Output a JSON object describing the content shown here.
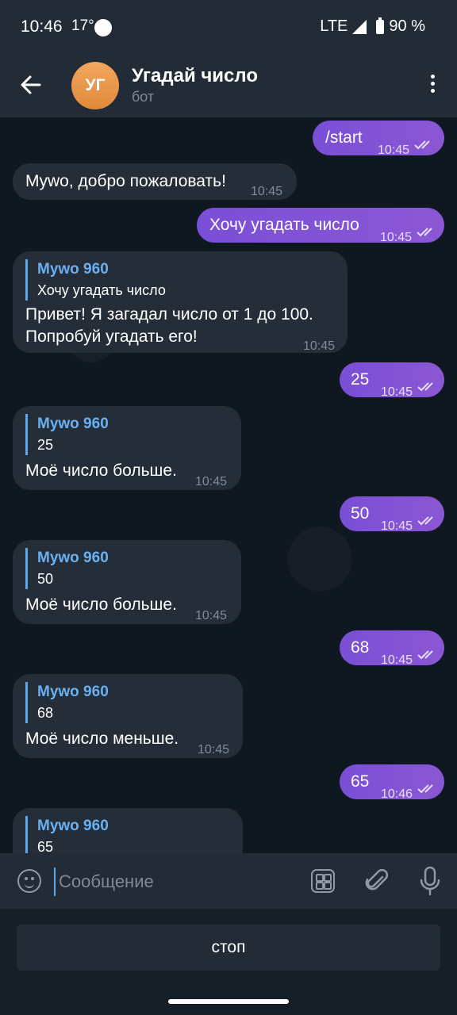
{
  "status_bar": {
    "time": "10:46",
    "temperature": "17°",
    "network": "LTE",
    "battery": "90 %"
  },
  "header": {
    "avatar_initials": "УГ",
    "title": "Угадай число",
    "subtitle": "бот"
  },
  "messages": [
    {
      "dir": "out",
      "text": "/start",
      "time": "10:45"
    },
    {
      "dir": "in",
      "text": "Мywo, добро пожаловать!",
      "time": "10:45"
    },
    {
      "dir": "out",
      "text": "Хочу угадать число",
      "time": "10:45"
    },
    {
      "dir": "in",
      "reply_name": "Мywo 960",
      "reply_text": "Хочу угадать число",
      "text_line1": "Привет! Я загадал число от 1 до 100.",
      "text_line2": "Попробуй угадать его!",
      "time": "10:45"
    },
    {
      "dir": "out",
      "text": "25",
      "time": "10:45"
    },
    {
      "dir": "in",
      "reply_name": "Мywo 960",
      "reply_text": "25",
      "text": "Моё число больше.",
      "time": "10:45"
    },
    {
      "dir": "out",
      "text": "50",
      "time": "10:45"
    },
    {
      "dir": "in",
      "reply_name": "Мywo 960",
      "reply_text": "50",
      "text": "Моё число больше.",
      "time": "10:45"
    },
    {
      "dir": "out",
      "text": "68",
      "time": "10:45"
    },
    {
      "dir": "in",
      "reply_name": "Мywo 960",
      "reply_text": "68",
      "text": "Моё число меньше.",
      "time": "10:45"
    },
    {
      "dir": "out",
      "text": "65",
      "time": "10:46"
    },
    {
      "dir": "in",
      "reply_name": "Мywo 960",
      "reply_text": "65"
    }
  ],
  "input": {
    "placeholder": "Сообщение"
  },
  "keyboard": {
    "stop_label": "стоп"
  }
}
